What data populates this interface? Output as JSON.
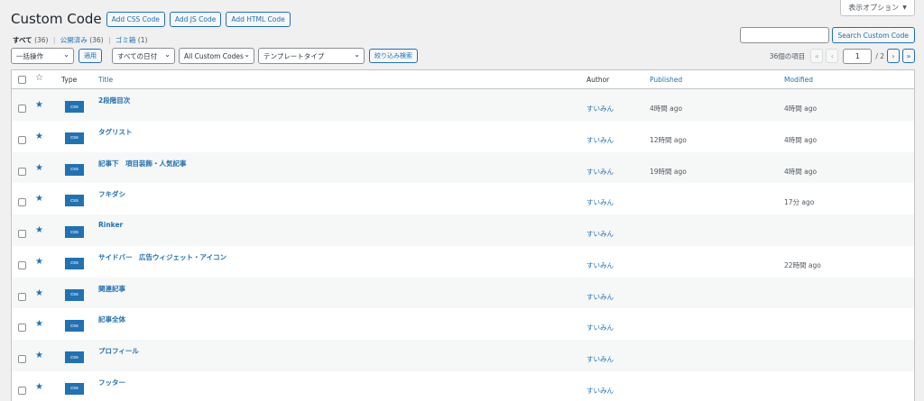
{
  "screen_options": {
    "label": "表示オプション",
    "arrow": "▼"
  },
  "header": {
    "title": "Custom Code",
    "buttons": [
      "Add CSS Code",
      "Add JS Code",
      "Add HTML Code"
    ]
  },
  "filters_links": {
    "all": {
      "label": "すべて",
      "count": "(36)"
    },
    "published": {
      "label": "公開済み",
      "count": "(36)"
    },
    "trash": {
      "label": "ゴミ箱",
      "count": "(1)"
    },
    "separator": "|"
  },
  "search": {
    "input_value": "",
    "button": "Search Custom Code"
  },
  "tablenav": {
    "bulk_action": "一括操作",
    "apply": "適用",
    "date_filter": "すべての日付",
    "code_filter": "All Custom Codes",
    "template_filter": "テンプレートタイプ",
    "filter_button": "絞り込み検索",
    "chevron": "⌄"
  },
  "pagination": {
    "items": "36個の項目",
    "first": "«",
    "prev": "‹",
    "next": "›",
    "last": "»",
    "current": "1",
    "total": "/ 2"
  },
  "table": {
    "columns": {
      "type": "Type",
      "title": "Title",
      "author": "Author",
      "published": "Published",
      "modified": "Modified"
    },
    "rows": [
      {
        "type": "css",
        "title": "2段階目次",
        "author": "すいみん",
        "published": "4時間 ago",
        "modified": "4時間 ago"
      },
      {
        "type": "css",
        "title": "タグリスト",
        "author": "すいみん",
        "published": "12時間 ago",
        "modified": "4時間 ago"
      },
      {
        "type": "css",
        "title": "記事下　項目装飾・人気記事",
        "author": "すいみん",
        "published": "19時間 ago",
        "modified": "4時間 ago"
      },
      {
        "type": "css",
        "title": "フキダシ",
        "author": "すいみん",
        "published": "",
        "modified": "17分 ago"
      },
      {
        "type": "css",
        "title": "Rinker",
        "author": "すいみん",
        "published": "",
        "modified": ""
      },
      {
        "type": "css",
        "title": "サイドバー　広告ウィジェット・アイコン",
        "author": "すいみん",
        "published": "",
        "modified": "22時間 ago"
      },
      {
        "type": "css",
        "title": "関連記事",
        "author": "すいみん",
        "published": "",
        "modified": ""
      },
      {
        "type": "css",
        "title": "記事全体",
        "author": "すいみん",
        "published": "",
        "modified": ""
      },
      {
        "type": "css",
        "title": "プロフィール",
        "author": "すいみん",
        "published": "",
        "modified": ""
      },
      {
        "type": "css",
        "title": "フッター",
        "author": "すいみん",
        "published": "",
        "modified": ""
      }
    ]
  },
  "colors": {
    "accent": "#2271b1",
    "background": "#f0f0f1",
    "text": "#3c434a"
  }
}
